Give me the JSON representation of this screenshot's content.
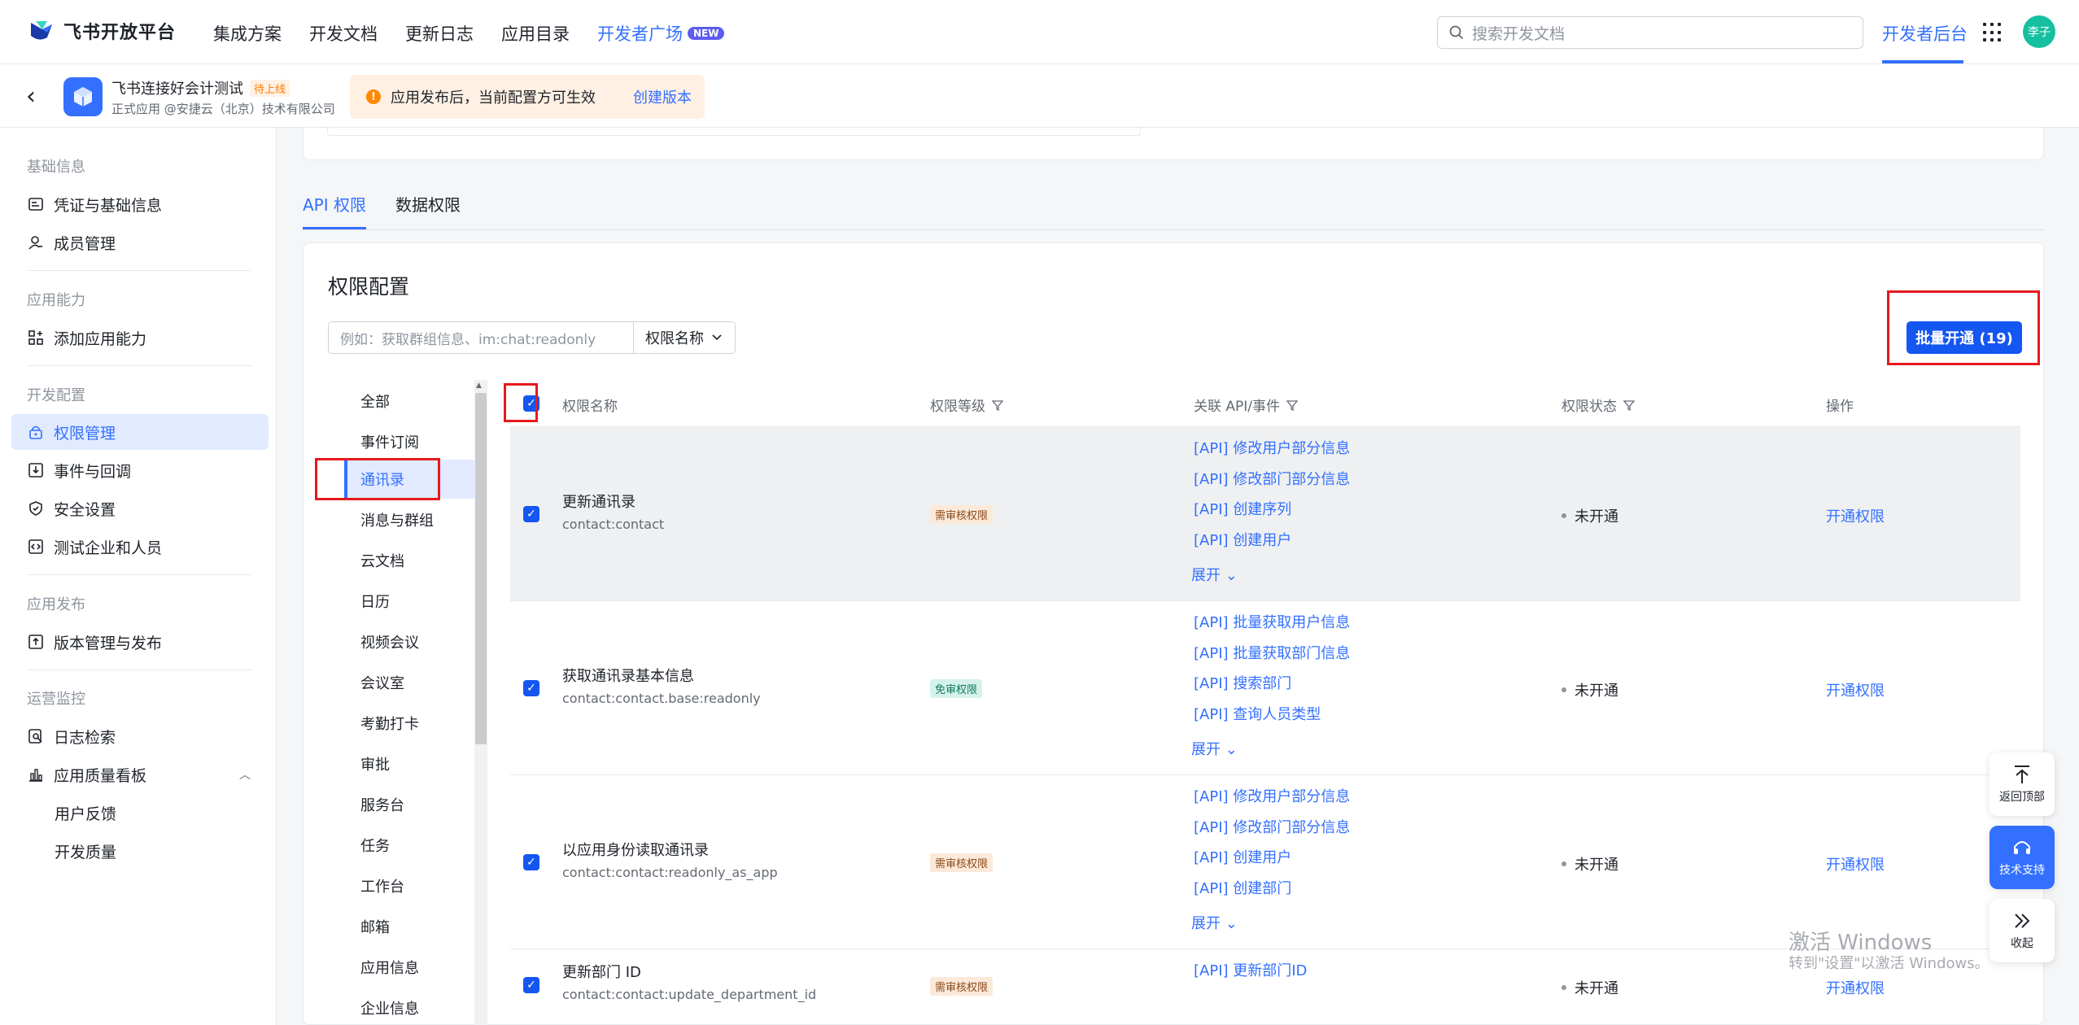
{
  "topnav": {
    "logo_text": "飞书开放平台",
    "links": [
      {
        "label": "集成方案"
      },
      {
        "label": "开发文档"
      },
      {
        "label": "更新日志"
      },
      {
        "label": "应用目录"
      },
      {
        "label": "开发者广场",
        "badge": "NEW"
      }
    ],
    "search_placeholder": "搜索开发文档",
    "dev_console": "开发者后台",
    "avatar": "李子"
  },
  "app": {
    "name": "飞书连接好会计测试",
    "status_tag": "待上线",
    "subtitle": "正式应用 @安捷云（北京）技术有限公司",
    "notice": "应用发布后，当前配置方可生效",
    "notice_link": "创建版本"
  },
  "sidebar": {
    "groups": [
      {
        "title": "基础信息",
        "items": [
          "凭证与基础信息",
          "成员管理"
        ]
      },
      {
        "title": "应用能力",
        "items": [
          "添加应用能力"
        ]
      },
      {
        "title": "开发配置",
        "items": [
          "权限管理",
          "事件与回调",
          "安全设置",
          "测试企业和人员"
        ]
      },
      {
        "title": "应用发布",
        "items": [
          "版本管理与发布"
        ]
      },
      {
        "title": "运营监控",
        "items": [
          "日志检索",
          "应用质量看板"
        ],
        "subitems": [
          "用户反馈",
          "开发质量"
        ]
      }
    ]
  },
  "tabs": [
    {
      "label": "API 权限"
    },
    {
      "label": "数据权限"
    }
  ],
  "config": {
    "title": "权限配置",
    "filter_placeholder": "例如：获取群组信息、im:chat:readonly",
    "filter_select": "权限名称",
    "batch_button": "批量开通 (19)"
  },
  "categories": [
    "全部",
    "事件订阅",
    "通讯录",
    "消息与群组",
    "云文档",
    "日历",
    "视频会议",
    "会议室",
    "考勤打卡",
    "审批",
    "服务台",
    "任务",
    "工作台",
    "邮箱",
    "应用信息",
    "企业信息"
  ],
  "table": {
    "headers": [
      "权限名称",
      "权限等级",
      "关联 API/事件",
      "权限状态",
      "操作"
    ],
    "expand_label": "展开",
    "rows": [
      {
        "name": "更新通讯录",
        "code": "contact:contact",
        "level": "需审核权限",
        "level_type": "review",
        "apis": [
          "[API] 修改用户部分信息",
          "[API] 修改部门部分信息",
          "[API] 创建序列",
          "[API] 创建用户"
        ],
        "status": "未开通",
        "action": "开通权限"
      },
      {
        "name": "获取通讯录基本信息",
        "code": "contact:contact.base:readonly",
        "level": "免审权限",
        "level_type": "free",
        "apis": [
          "[API] 批量获取用户信息",
          "[API] 批量获取部门信息",
          "[API] 搜索部门",
          "[API] 查询人员类型"
        ],
        "status": "未开通",
        "action": "开通权限"
      },
      {
        "name": "以应用身份读取通讯录",
        "code": "contact:contact:readonly_as_app",
        "level": "需审核权限",
        "level_type": "review",
        "apis": [
          "[API] 修改用户部分信息",
          "[API] 修改部门部分信息",
          "[API] 创建用户",
          "[API] 创建部门"
        ],
        "status": "未开通",
        "action": "开通权限"
      },
      {
        "name": "更新部门 ID",
        "code": "contact:contact:update_department_id",
        "level": "需审核权限",
        "level_type": "review",
        "apis": [
          "[API] 更新部门ID"
        ],
        "status": "未开通",
        "action": "开通权限"
      }
    ]
  },
  "floating": {
    "top": "返回顶部",
    "support": "技术支持",
    "collapse": "收起"
  },
  "watermark": {
    "line1": "激活 Windows",
    "line2": "转到\"设置\"以激活 Windows。"
  }
}
